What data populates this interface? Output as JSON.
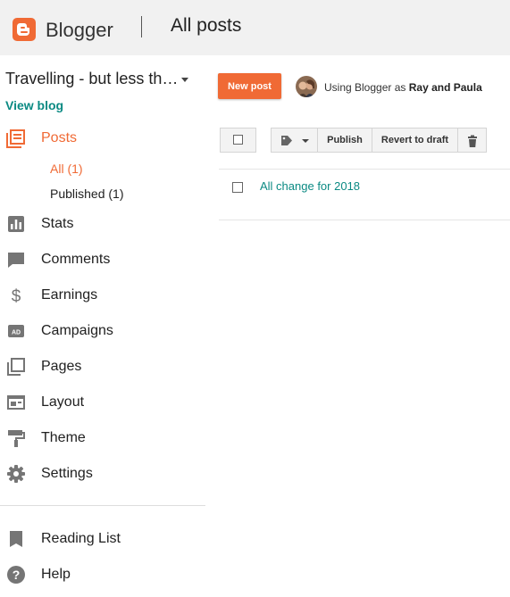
{
  "header": {
    "brand": "Blogger",
    "page_title": "All posts"
  },
  "blog": {
    "name": "Travelling - but less th…",
    "view_blog": "View blog"
  },
  "nav": {
    "posts": "Posts",
    "sub": {
      "all": "All (1)",
      "published": "Published (1)"
    },
    "stats": "Stats",
    "comments": "Comments",
    "earnings": "Earnings",
    "campaigns": "Campaigns",
    "pages": "Pages",
    "layout": "Layout",
    "theme": "Theme",
    "settings": "Settings",
    "reading_list": "Reading List",
    "help": "Help"
  },
  "toolbar": {
    "new_post": "New post",
    "using_prefix": "Using Blogger as",
    "user_name": "Ray and Paula",
    "publish": "Publish",
    "revert": "Revert to draft"
  },
  "posts": [
    {
      "title": "All change for 2018"
    }
  ],
  "icons": {
    "logo": "blogger-logo-icon",
    "posts": "posts-icon",
    "stats": "stats-icon",
    "comments": "comments-icon",
    "earnings": "dollar-icon",
    "campaigns": "ad-icon",
    "pages": "pages-icon",
    "layout": "layout-icon",
    "theme": "paint-roller-icon",
    "settings": "gear-icon",
    "reading_list": "bookmark-icon",
    "help": "help-icon",
    "label": "label-tag-icon",
    "delete": "trash-icon"
  },
  "colors": {
    "accent": "#f06a35",
    "link": "#0b8a83",
    "icon_gray": "#757575"
  }
}
